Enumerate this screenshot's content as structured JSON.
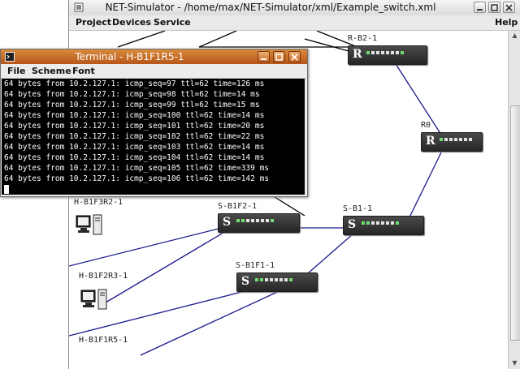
{
  "main_window": {
    "title": "NET-Simulator - /home/max/NET-Simulator/xml/Example_switch.xml",
    "menu": [
      "Project",
      "Devices",
      "Service"
    ],
    "help": "Help"
  },
  "devices": {
    "r_b2_1": {
      "letter": "R",
      "label": "R-B2-1"
    },
    "r0": {
      "letter": "R",
      "label": "R0"
    },
    "s_b1f2_1": {
      "letter": "S",
      "label": "S-B1F2-1"
    },
    "s_b1_1": {
      "letter": "S",
      "label": "S-B1-1"
    },
    "s_b1f1_1": {
      "letter": "S",
      "label": "S-B1F1-1"
    },
    "h_b1f3r2_1": {
      "label": "H-B1F3R2-1"
    },
    "h_b1f2r3_1": {
      "label": "H-B1F2R3-1"
    },
    "h_b1f1r5_1": {
      "label": "H-B1F1R5-1"
    }
  },
  "terminal": {
    "title": "Terminal - H-B1F1R5-1",
    "menu": [
      "File",
      "Scheme",
      "Font"
    ],
    "lines": [
      "64 bytes from 10.2.127.1: icmp_seq=97 ttl=62 time=126 ms",
      "64 bytes from 10.2.127.1: icmp_seq=98 ttl=62 time=14 ms",
      "64 bytes from 10.2.127.1: icmp_seq=99 ttl=62 time=15 ms",
      "64 bytes from 10.2.127.1: icmp_seq=100 ttl=62 time=14 ms",
      "64 bytes from 10.2.127.1: icmp_seq=101 ttl=62 time=20 ms",
      "64 bytes from 10.2.127.1: icmp_seq=102 ttl=62 time=22 ms",
      "64 bytes from 10.2.127.1: icmp_seq=103 ttl=62 time=14 ms",
      "64 bytes from 10.2.127.1: icmp_seq=104 ttl=62 time=14 ms",
      "64 bytes from 10.2.127.1: icmp_seq=105 ttl=62 time=339 ms",
      "64 bytes from 10.2.127.1: icmp_seq=106 ttl=62 time=142 ms"
    ]
  },
  "colors": {
    "link_blue": "#1a1a8c",
    "link_black": "#000000",
    "terminal_titlebar": "#c86a28"
  }
}
